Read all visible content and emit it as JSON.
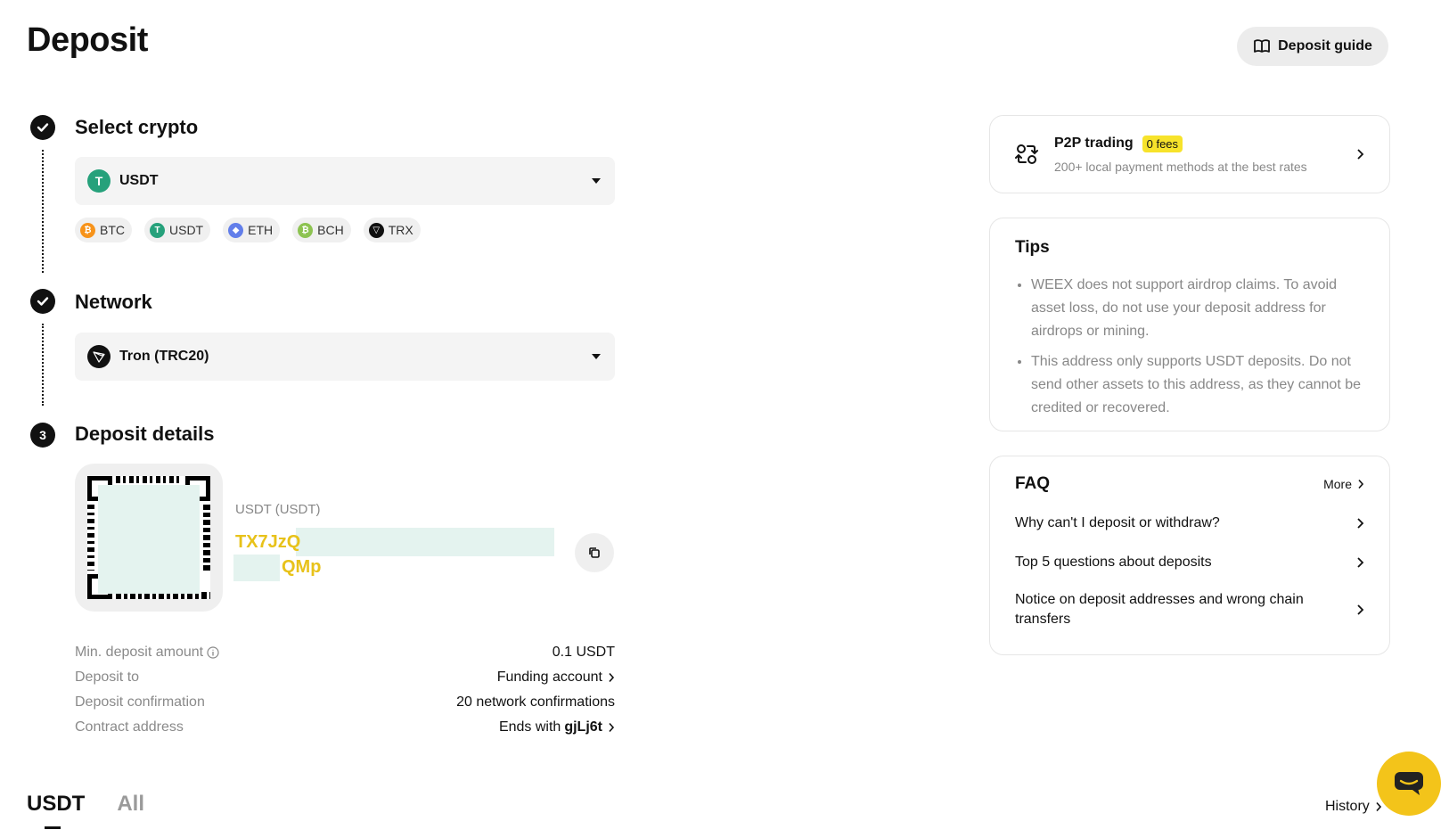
{
  "page": {
    "title": "Deposit"
  },
  "header": {
    "guide_label": "Deposit guide",
    "guide_icon": "book-open-icon"
  },
  "steps": {
    "select_crypto": {
      "label": "Select crypto",
      "selected": "USDT",
      "status": "done"
    },
    "network": {
      "label": "Network",
      "selected": "Tron (TRC20)",
      "status": "done"
    },
    "details": {
      "number": "3",
      "label": "Deposit details"
    }
  },
  "coin_chips": [
    {
      "label": "BTC",
      "color": "#f7931a",
      "glyph": "₿"
    },
    {
      "label": "USDT",
      "color": "#26a17b",
      "glyph": "T"
    },
    {
      "label": "ETH",
      "color": "#627eea",
      "glyph": "◆"
    },
    {
      "label": "BCH",
      "color": "#8dc351",
      "glyph": "₿"
    },
    {
      "label": "TRX",
      "color": "#111111",
      "glyph": "▽"
    }
  ],
  "deposit": {
    "address_label": "USDT (USDT)",
    "address_line1": "TX7JzQ",
    "address_line2": "QMp",
    "address_color": "#e8c21a",
    "info": [
      {
        "key": "Min. deposit amount",
        "value": "0.1 USDT"
      },
      {
        "key": "Deposit to",
        "value": "Funding account"
      },
      {
        "key": "Deposit confirmation",
        "value": "20 network confirmations"
      },
      {
        "key": "Contract address",
        "value_prefix": "Ends with",
        "value_bold": "gjLj6t"
      }
    ]
  },
  "tabs": [
    {
      "label": "USDT",
      "active": true
    },
    {
      "label": "All",
      "active": false
    }
  ],
  "history_label": "History",
  "p2p": {
    "title": "P2P trading",
    "badge": "0 fees",
    "subtitle": "200+ local payment methods at the best rates",
    "badge_color": "#f7e32b"
  },
  "tips": {
    "title": "Tips",
    "items": [
      "WEEX does not support airdrop claims. To avoid asset loss, do not use your deposit address for airdrops or mining.",
      "This address only supports USDT deposits. Do not send other assets to this address, as they cannot be credited or recovered."
    ]
  },
  "faq": {
    "title": "FAQ",
    "more_label": "More",
    "items": [
      "Why can't I deposit or withdraw?",
      "Top 5 questions about deposits",
      "Notice on deposit addresses and wrong chain transfers"
    ]
  },
  "colors": {
    "accent": "#f3c41a",
    "usdt": "#26a17b"
  }
}
